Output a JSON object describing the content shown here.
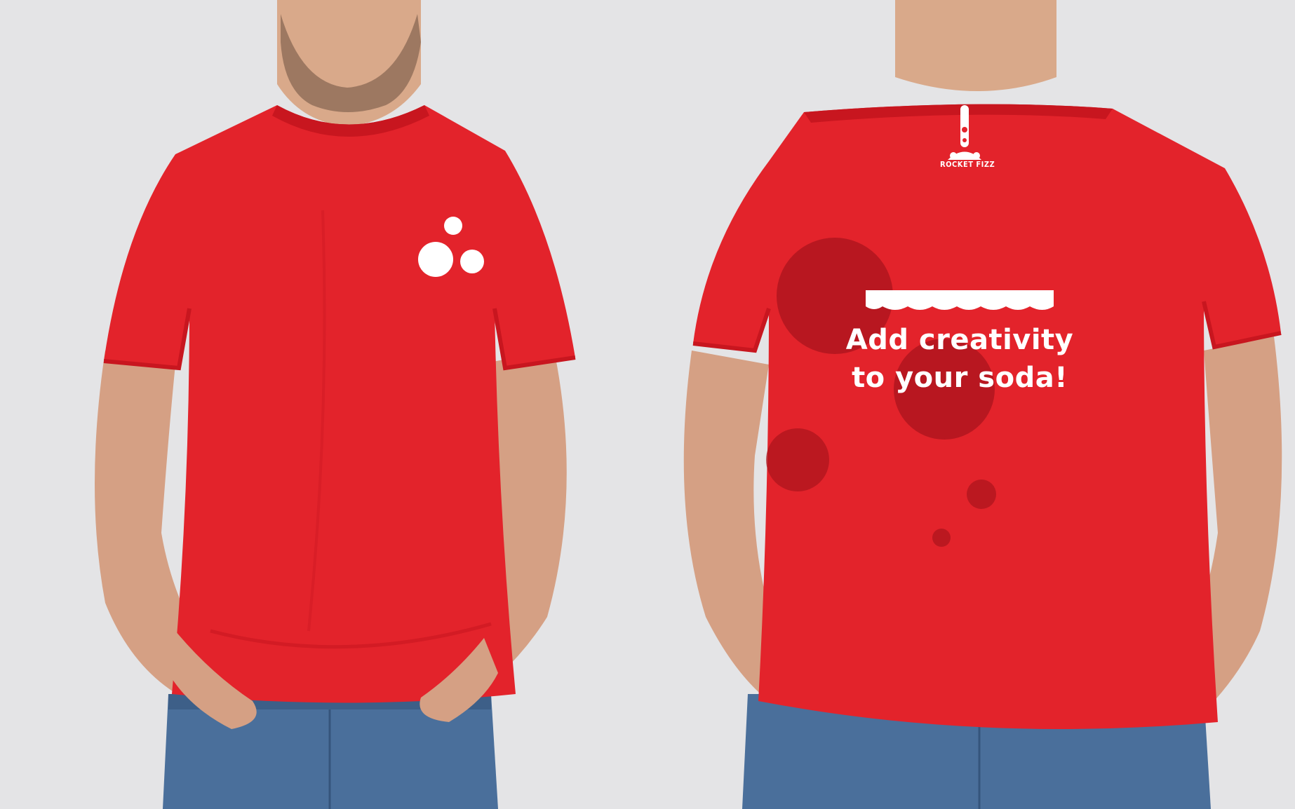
{
  "scene": {
    "description_panels": [
      "front-view",
      "back-view"
    ]
  },
  "back_print": {
    "slogan_line1": "Add creativity",
    "slogan_line2": "to your soda!",
    "logo_text": "ROCKET FIZZ"
  },
  "colors": {
    "background": "#e4e4e6",
    "shirt_red": "#e3232b",
    "shirt_shadow": "#c8161f",
    "bubble_dark": "#a9141d",
    "print_white": "#ffffff",
    "denim": "#4a6f9b",
    "skin": "#d9a98a"
  }
}
